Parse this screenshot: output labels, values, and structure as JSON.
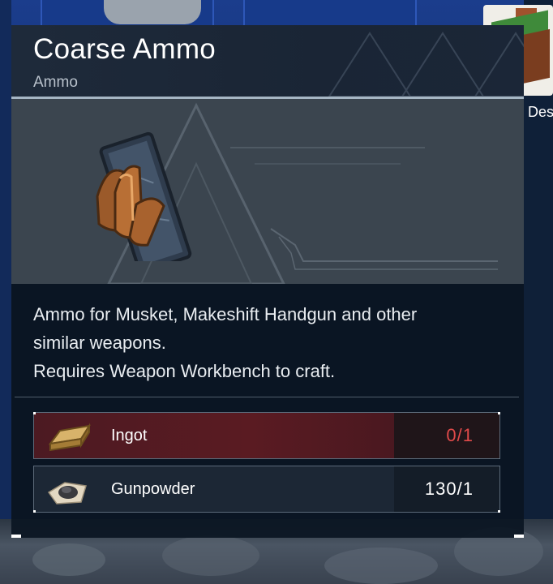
{
  "tooltip": {
    "title": "Coarse Ammo",
    "category": "Ammo",
    "icon": "ammo-icon",
    "description_lines": [
      "Ammo for Musket, Makeshift Handgun and other",
      "similar weapons.",
      "Requires Weapon Workbench to craft."
    ],
    "materials": [
      {
        "name": "Ingot",
        "icon": "ingot-icon",
        "have": "0",
        "sep": "/",
        "need": "1",
        "sufficient": false
      },
      {
        "name": "Gunpowder",
        "icon": "gunpowder-icon",
        "have": "130",
        "sep": "/",
        "need": "1",
        "sufficient": true
      }
    ]
  },
  "background": {
    "desk_label": "Des"
  },
  "colors": {
    "insufficient": "#e04a4a",
    "panel": "#0b1622",
    "header_line": "#a6b6c4"
  }
}
